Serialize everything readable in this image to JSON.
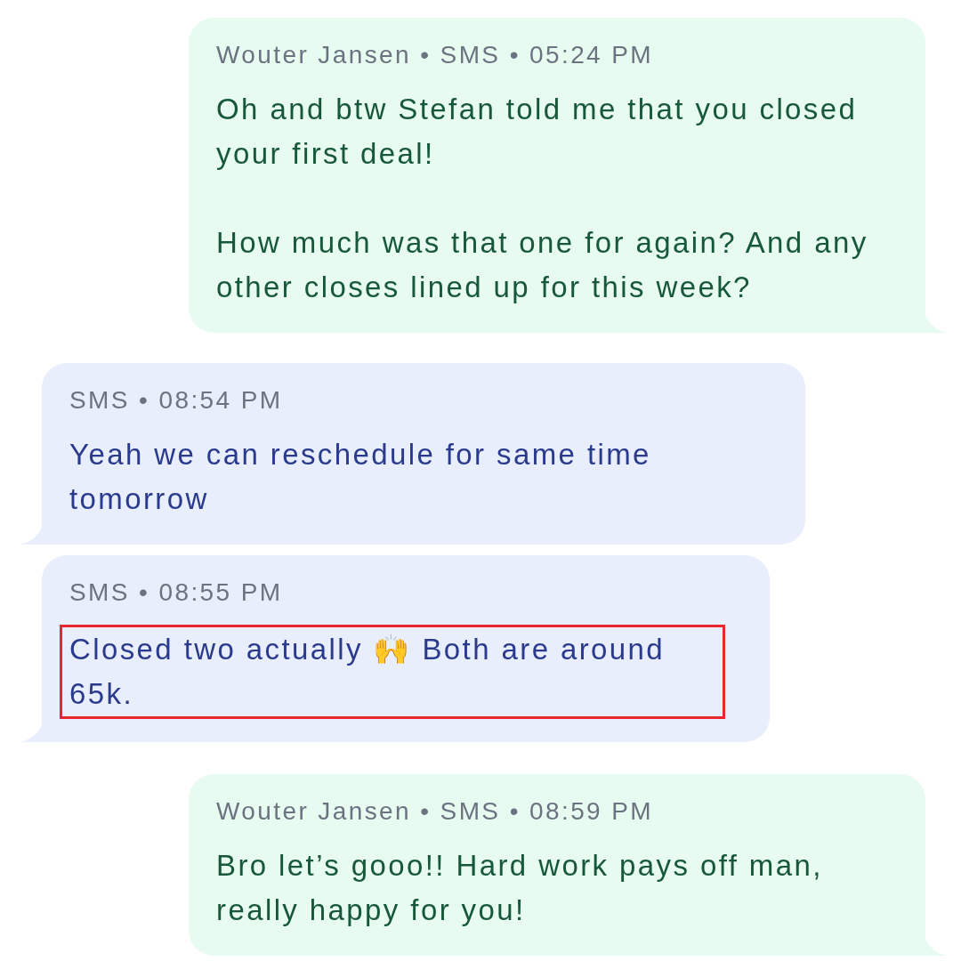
{
  "messages": [
    {
      "kind": "outgoing",
      "meta": "Wouter Jansen • SMS • 05:24 PM",
      "paragraphs": [
        "Oh and btw Stefan told me that you closed your first deal!",
        "How much was that one for again? And any other closes lined up for this week?"
      ],
      "highlighted": false
    },
    {
      "kind": "incoming",
      "meta": "SMS • 08:54 PM",
      "paragraphs": [
        "Yeah we can reschedule for same time tomorrow"
      ],
      "highlighted": false
    },
    {
      "kind": "incoming",
      "meta": "SMS • 08:55 PM",
      "paragraphs": [
        "Closed two actually 🙌  Both are around 65k."
      ],
      "highlighted": true
    },
    {
      "kind": "outgoing",
      "meta": "Wouter Jansen • SMS • 08:59 PM",
      "paragraphs": [
        "Bro let’s gooo!! Hard work pays off man, really happy for you!"
      ],
      "highlighted": false
    }
  ]
}
